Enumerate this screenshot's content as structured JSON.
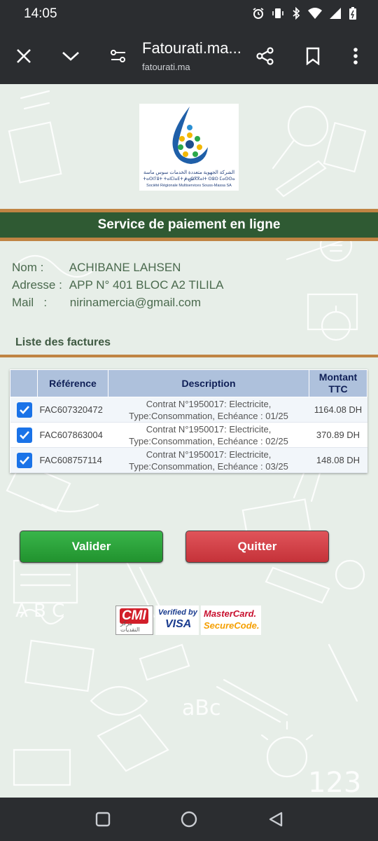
{
  "status": {
    "time": "14:05"
  },
  "browser": {
    "title": "Fatourati.ma...",
    "domain": "fatourati.ma"
  },
  "logo": {
    "arabic_name": "الشركة الجهوية متعددة الخدمات سوس ماسة ش.م",
    "tifinagh_name": "ⵜⴰⵙⵏⵢⵓⵜ ⵜⴰⵏⵎⵏⴰⴹⵜ ⵜⴰⵙⴳⴳⴰⵏⵜ ⵙⵓⵙ ⵎⴰⵙⵙⴰ",
    "french_name": "Société Régionale Multiservices Souss-Massa SA"
  },
  "banner": {
    "title": "Service de paiement en ligne"
  },
  "client": {
    "nom_label": "Nom :",
    "nom": "ACHIBANE LAHSEN",
    "adresse_label": "Adresse :",
    "adresse": "APP N° 401 BLOC A2 TILILA",
    "mail_label": "Mail   :",
    "mail": "nirinamercia@gmail.com"
  },
  "invoices": {
    "section_title": "Liste des factures",
    "headers": {
      "reference": "Référence",
      "description": "Description",
      "amount_line1": "Montant",
      "amount_line2": "TTC"
    },
    "rows": [
      {
        "checked": true,
        "reference": "FAC607320472",
        "desc_line1": "Contrat N°1950017: Electricite,",
        "desc_line2": "Type:Consommation, Echéance : 01/25",
        "amount": "1164.08 DH"
      },
      {
        "checked": true,
        "reference": "FAC607863004",
        "desc_line1": "Contrat N°1950017: Electricite,",
        "desc_line2": "Type:Consommation, Echéance : 02/25",
        "amount": "370.89 DH"
      },
      {
        "checked": true,
        "reference": "FAC608757114",
        "desc_line1": "Contrat N°1950017: Electricite,",
        "desc_line2": "Type:Consommation, Echéance : 03/25",
        "amount": "148.08 DH"
      }
    ]
  },
  "actions": {
    "validate_label": "Valider",
    "quit_label": "Quitter"
  },
  "payment_logos": {
    "cmi": "CMI",
    "cmi_arabic": "مركز النقديات",
    "visa_line1": "Verified by",
    "visa_line2": "VISA",
    "mc_line1": "MasterCard.",
    "mc_line2": "SecureCode."
  },
  "colors": {
    "banner_green": "#2f5a33",
    "accent_orange": "#c08443",
    "valider_green": "#2ea23c",
    "quitter_red": "#d0393f",
    "table_header": "#aec1dc"
  },
  "icons": [
    "close-icon",
    "chevron-down-icon",
    "page-settings-icon",
    "share-icon",
    "bookmark-icon",
    "more-icon",
    "alarm-icon",
    "vibrate-icon",
    "bluetooth-icon",
    "wifi-icon",
    "signal-icon",
    "battery-icon",
    "nav-recent-icon",
    "nav-home-icon",
    "nav-back-icon",
    "checkbox-checked-icon"
  ]
}
